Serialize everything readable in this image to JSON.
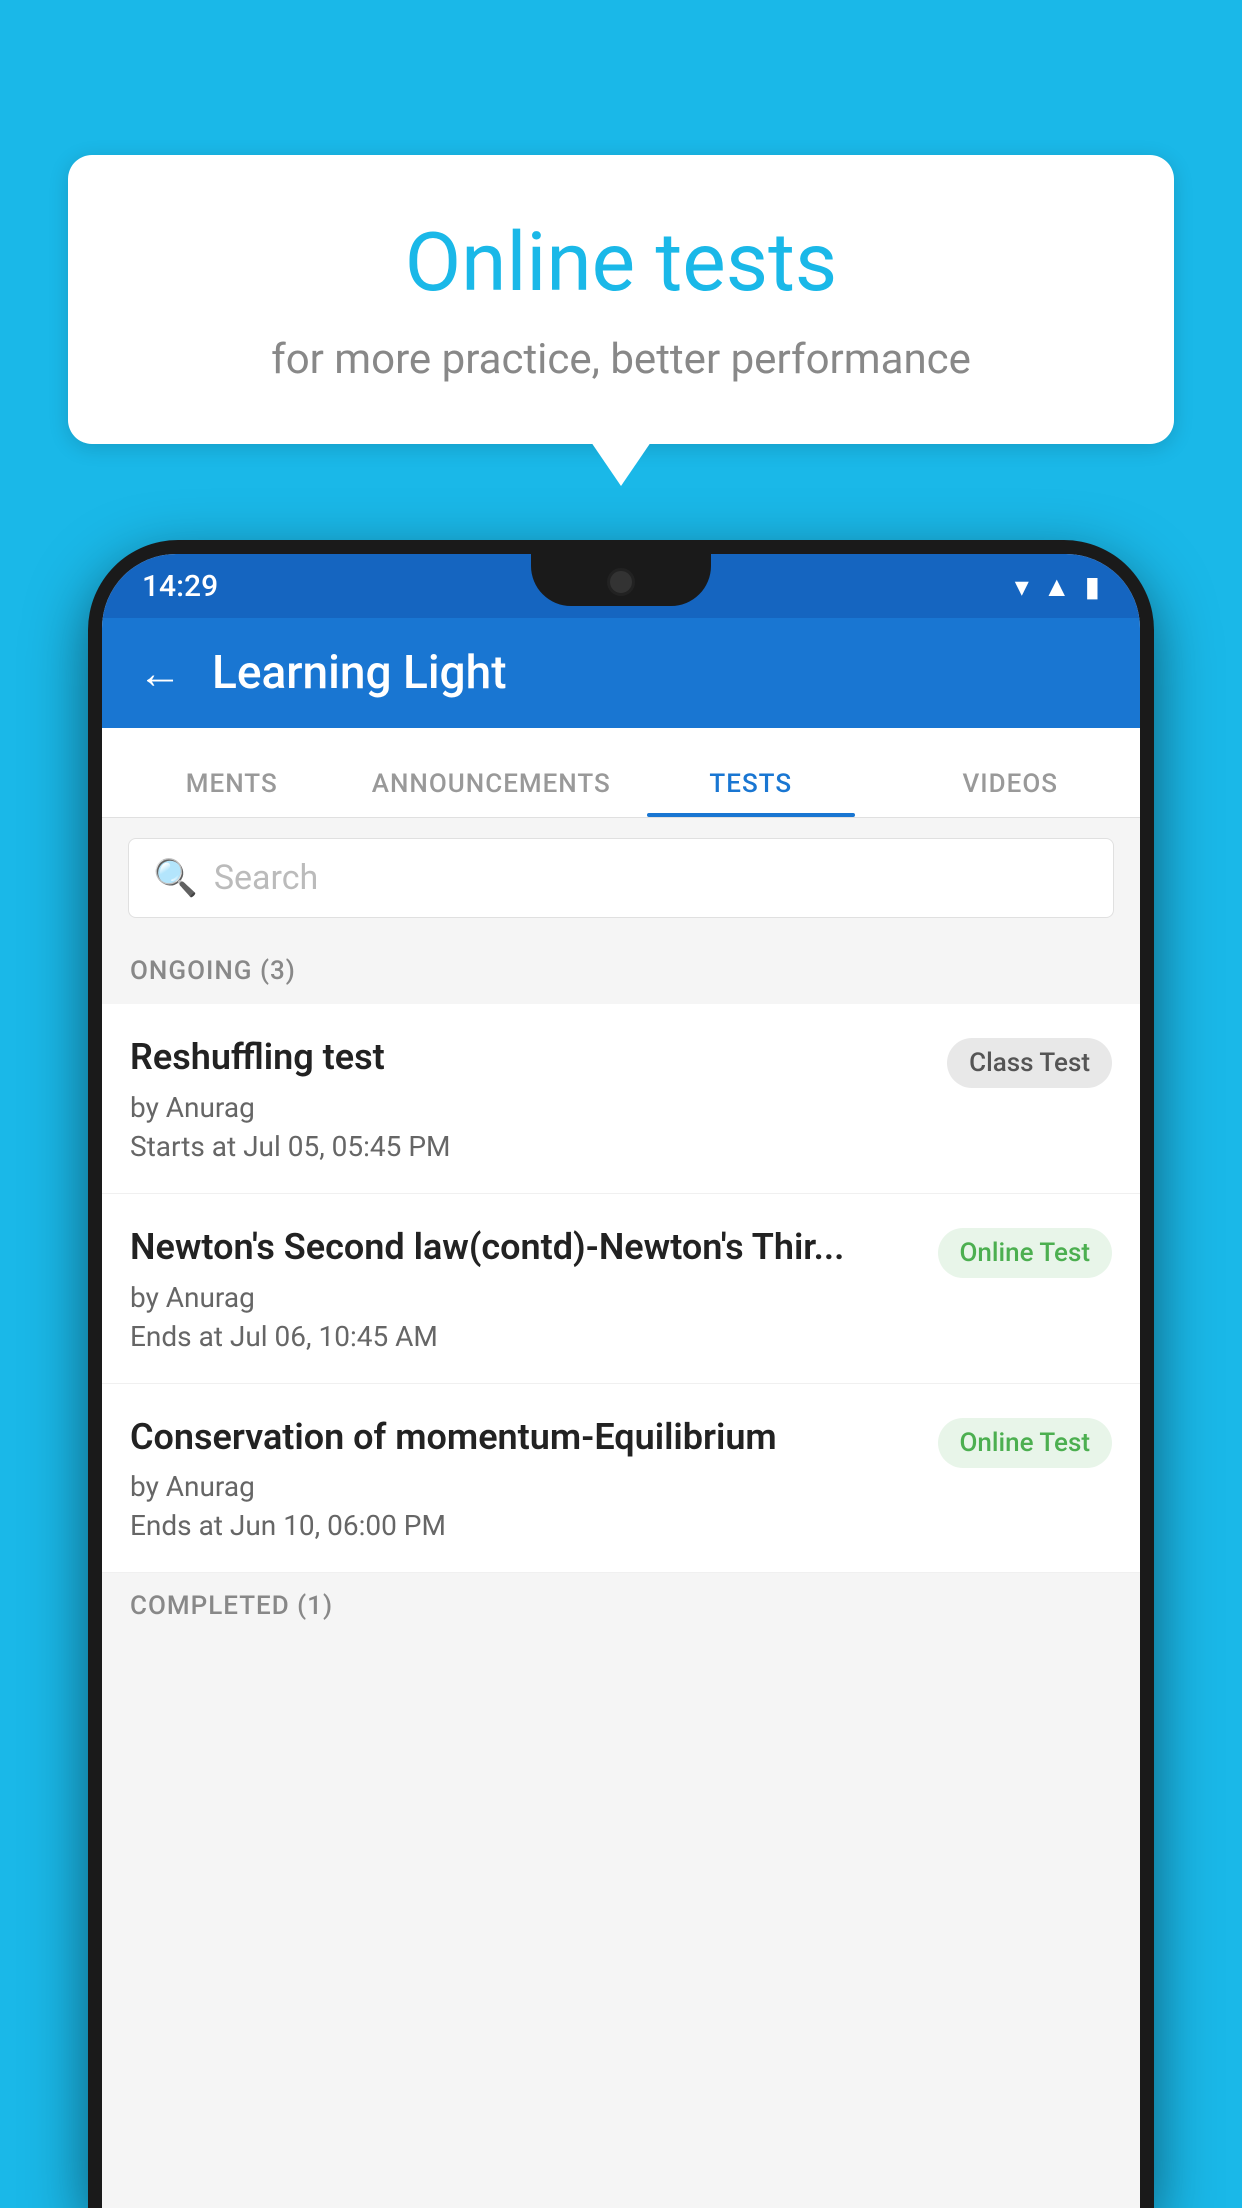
{
  "background": {
    "color": "#1ab8e8"
  },
  "speech_bubble": {
    "title": "Online tests",
    "subtitle": "for more practice, better performance"
  },
  "phone": {
    "status_bar": {
      "time": "14:29",
      "icons": [
        "wifi",
        "signal",
        "battery"
      ]
    },
    "app_bar": {
      "back_label": "←",
      "title": "Learning Light"
    },
    "tabs": [
      {
        "label": "MENTS",
        "active": false
      },
      {
        "label": "ANNOUNCEMENTS",
        "active": false
      },
      {
        "label": "TESTS",
        "active": true
      },
      {
        "label": "VIDEOS",
        "active": false
      }
    ],
    "search": {
      "placeholder": "Search",
      "icon": "search"
    },
    "sections": [
      {
        "label": "ONGOING (3)",
        "tests": [
          {
            "title": "Reshuffling test",
            "author": "by Anurag",
            "date": "Starts at  Jul 05, 05:45 PM",
            "badge": "Class Test",
            "badge_type": "class"
          },
          {
            "title": "Newton's Second law(contd)-Newton's Thir...",
            "author": "by Anurag",
            "date": "Ends at  Jul 06, 10:45 AM",
            "badge": "Online Test",
            "badge_type": "online"
          },
          {
            "title": "Conservation of momentum-Equilibrium",
            "author": "by Anurag",
            "date": "Ends at  Jun 10, 06:00 PM",
            "badge": "Online Test",
            "badge_type": "online"
          }
        ]
      }
    ],
    "completed_section": {
      "label": "COMPLETED (1)"
    }
  }
}
